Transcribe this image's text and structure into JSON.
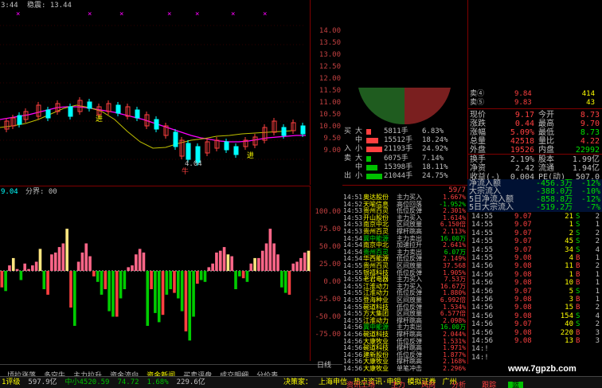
{
  "app": {
    "top_left_time": "3:44",
    "top_label": "稳震: 13.44",
    "watermark": "www.7gpzb.com"
  },
  "price_chart": {
    "axis_labels": [
      "14.00",
      "13.50",
      "13.00",
      "12.50",
      "12.00",
      "11.50",
      "11.00",
      "10.50",
      "10.00",
      "9.50",
      "9.00"
    ],
    "low_label": "4.04",
    "tags": [
      "进",
      "进",
      "牛"
    ]
  },
  "indicator": {
    "header_left": "9.04",
    "header_label": "分界: 00",
    "axis_labels": [
      "100.00",
      "75.00",
      "50.00",
      "25.00",
      "0.00",
      "-25.00",
      "-50.00",
      "-75.00"
    ]
  },
  "bottom_tabs": [
    "顷拉涨落",
    "多空牛",
    "主力拉升",
    "资金流向",
    "资金新闻",
    "买卖评盘",
    "成交明细",
    "分价表"
  ],
  "bottom_tabs_active_index": 4,
  "day_label": "日线",
  "status_bar": {
    "items": [
      "1评级",
      "597.9亿",
      "中小4520.59",
      "74.72",
      "1.68%",
      "229.6亿"
    ],
    "news": [
      "决策家：",
      "上海申信",
      "热点资讯·申银",
      "模拟证券",
      "广州"
    ],
    "right_tabs": [
      "资讯工场",
      "主力",
      "风向",
      "分析",
      "跟踪",
      "篮"
    ]
  },
  "quote": {
    "sell_rows": [
      {
        "label": "卖④",
        "price": "9.84",
        "vol": "414"
      },
      {
        "label": "卖⑤",
        "price": "9.83",
        "vol": "43"
      }
    ],
    "stats": [
      {
        "l1": "现价",
        "v1": "9.17",
        "l2": "今开",
        "v2": "8.73"
      },
      {
        "l1": "涨跌",
        "v1": "0.44",
        "l2": "最高",
        "v2": "9.70"
      },
      {
        "l1": "涨幅",
        "v1": "5.09%",
        "l2": "最低",
        "v2": "8.73"
      },
      {
        "l1": "总量",
        "v1": "42518",
        "l2": "量比",
        "v2": "4.22"
      },
      {
        "l1": "外盘",
        "v1": "19526",
        "l2": "内盘",
        "v2": "22992"
      }
    ],
    "stats2": [
      {
        "l1": "换手",
        "v1": "2.19%",
        "l2": "股本",
        "v2": "1.99亿"
      },
      {
        "l1": "净资",
        "v1": "2.42",
        "l2": "流通",
        "v2": "1.94亿"
      },
      {
        "l1": "收益(-)",
        "v1": "0.004",
        "l2": "PE(动)",
        "v2": "507.0"
      }
    ]
  },
  "flow_bars": {
    "buy_label": "买",
    "sell_label": "卖",
    "in_label": "入",
    "out_label": "出",
    "rows": [
      {
        "size": "大",
        "vol": "5811手",
        "pct": "6.83%",
        "bar": 0.28,
        "color": "#ff4040"
      },
      {
        "size": "中",
        "vol": "15512手",
        "pct": "18.24%",
        "bar": 0.73,
        "color": "#ff4040"
      },
      {
        "size": "小",
        "vol": "21193手",
        "pct": "24.92%",
        "bar": 1.0,
        "color": "#ff4040"
      },
      {
        "size": "大",
        "vol": "6075手",
        "pct": "7.14%",
        "bar": 0.29,
        "color": "#00c000"
      },
      {
        "size": "中",
        "vol": "15398手",
        "pct": "18.11%",
        "bar": 0.72,
        "color": "#00c000"
      },
      {
        "size": "小",
        "vol": "21044手",
        "pct": "24.75%",
        "bar": 0.99,
        "color": "#00c000"
      }
    ]
  },
  "net_flow": [
    {
      "label": "净流入额",
      "value": "-456.3万",
      "pct": "-12%"
    },
    {
      "label": "大宗流入",
      "value": "-388.0万",
      "pct": "-10%"
    },
    {
      "label": "5日净流入额",
      "value": "-858.8万",
      "pct": "-12%"
    },
    {
      "label": "5日大宗流入",
      "value": "-519.2万",
      "pct": "-7%"
    }
  ],
  "news_list": {
    "header": "59/7",
    "rows": [
      {
        "time": "14:51",
        "name": "奥达股份",
        "signal": "主力买入",
        "val": "1.667%"
      },
      {
        "time": "14:52",
        "name": "天喻信息",
        "signal": "高位回落",
        "val": "-1.952%"
      },
      {
        "time": "14:53",
        "name": "贵州百灵",
        "signal": "低位反弹",
        "val": "2.301%"
      },
      {
        "time": "14:53",
        "name": "开山股份",
        "signal": "主力买入",
        "val": "1.614%"
      },
      {
        "time": "14:53",
        "name": "南京中北",
        "signal": "区间放量",
        "val": "6.150倍"
      },
      {
        "time": "14:53",
        "name": "贵州百灵",
        "signal": "撑杆跳高",
        "val": "2.113%"
      },
      {
        "time": "14:54",
        "name": "冀中能源",
        "signal": "主力卖出",
        "val": "16.00万"
      },
      {
        "time": "14:54",
        "name": "南京中北",
        "signal": "加速拉升",
        "val": "2.641%"
      },
      {
        "time": "14:54",
        "name": "贵州百灵",
        "signal": "主力卖出",
        "val": "6.07万"
      },
      {
        "time": "14:54",
        "name": "华西能源",
        "signal": "低位反弹",
        "val": "2.149%"
      },
      {
        "time": "14:55",
        "name": "贵州百灵",
        "signal": "区间放量",
        "val": "37.568"
      },
      {
        "time": "14:55",
        "name": "银禧科技",
        "signal": "低位反弹",
        "val": "1.905%"
      },
      {
        "time": "14:55",
        "name": "老君电器",
        "signal": "主力买入",
        "val": "7.53万"
      },
      {
        "time": "14:55",
        "name": "江淮动力",
        "signal": "主力买入",
        "val": "16.67万"
      },
      {
        "time": "14:55",
        "name": "江淮动力",
        "signal": "低位反弹",
        "val": "1.880%"
      },
      {
        "time": "14:55",
        "name": "登海种业",
        "signal": "区间放量",
        "val": "6.992倍"
      },
      {
        "time": "14:55",
        "name": "碗道科技",
        "signal": "低位反弹",
        "val": "1.534%"
      },
      {
        "time": "14:55",
        "name": "方大集团",
        "signal": "区间放量",
        "val": "6.577倍"
      },
      {
        "time": "14:55",
        "name": "江淮动力",
        "signal": "撑杆跳高",
        "val": "2.098%"
      },
      {
        "time": "14:56",
        "name": "冀中能源",
        "signal": "主力卖出",
        "val": "16.00万"
      },
      {
        "time": "14:56",
        "name": "碗道科技",
        "signal": "撑杆跳高",
        "val": "2.044%"
      },
      {
        "time": "14:56",
        "name": "大康牧业",
        "signal": "低位反弹",
        "val": "1.531%"
      },
      {
        "time": "14:56",
        "name": "碗道科技",
        "signal": "撑杆跳高",
        "val": "1.971%"
      },
      {
        "time": "14:56",
        "name": "建新股份",
        "signal": "低位反弹",
        "val": "1.877%"
      },
      {
        "time": "14:56",
        "name": "大康牧业",
        "signal": "撑杆跳高",
        "val": "2.168%"
      },
      {
        "time": "14:56",
        "name": "大康牧业",
        "signal": "单笔冲击",
        "val": "2.296%"
      }
    ]
  },
  "ticks": [
    {
      "time": "14:55",
      "price": "9.07",
      "vol": "21",
      "bs": "S",
      "n": "2"
    },
    {
      "time": "14:55",
      "price": "9.07",
      "vol": "1",
      "bs": "S",
      "n": "1"
    },
    {
      "time": "14:55",
      "price": "9.07",
      "vol": "2",
      "bs": "S",
      "n": "2"
    },
    {
      "time": "14:55",
      "price": "9.07",
      "vol": "45",
      "bs": "S",
      "n": "2"
    },
    {
      "time": "14:55",
      "price": "9.07",
      "vol": "34",
      "bs": "S",
      "n": "4"
    },
    {
      "time": "14:55",
      "price": "9.08",
      "vol": "4",
      "bs": "B",
      "n": "1"
    },
    {
      "time": "14:56",
      "price": "9.08",
      "vol": "11",
      "bs": "B",
      "n": "2"
    },
    {
      "time": "14:56",
      "price": "9.08",
      "vol": "1",
      "bs": "B",
      "n": "1"
    },
    {
      "time": "14:56",
      "price": "9.08",
      "vol": "10",
      "bs": "B",
      "n": "1"
    },
    {
      "time": "14:56",
      "price": "9.07",
      "vol": "5",
      "bs": "S",
      "n": "1"
    },
    {
      "time": "14:56",
      "price": "9.08",
      "vol": "3",
      "bs": "B",
      "n": "1"
    },
    {
      "time": "14:56",
      "price": "9.08",
      "vol": "15",
      "bs": "B",
      "n": "2"
    },
    {
      "time": "14:56",
      "price": "9.08",
      "vol": "154",
      "bs": "S",
      "n": "4"
    },
    {
      "time": "14:56",
      "price": "9.07",
      "vol": "40",
      "bs": "S",
      "n": "2"
    },
    {
      "time": "14:56",
      "price": "9.08",
      "vol": "220",
      "bs": "B",
      "n": "3"
    },
    {
      "time": "14:56",
      "price": "9.08",
      "vol": "13",
      "bs": "B",
      "n": "3"
    },
    {
      "time": "14:!",
      "price": "",
      "vol": "",
      "bs": "",
      "n": ""
    },
    {
      "time": "14:!",
      "price": "",
      "vol": "",
      "bs": "",
      "n": ""
    }
  ],
  "colors": {
    "up": "#ff4040",
    "down": "#00e000",
    "yellow": "#ffff00",
    "cyan": "#00ffff",
    "magenta": "#ff00ff",
    "pink": "#ff6688",
    "light_green": "#66ff66",
    "pale_yellow": "#ffe680"
  }
}
